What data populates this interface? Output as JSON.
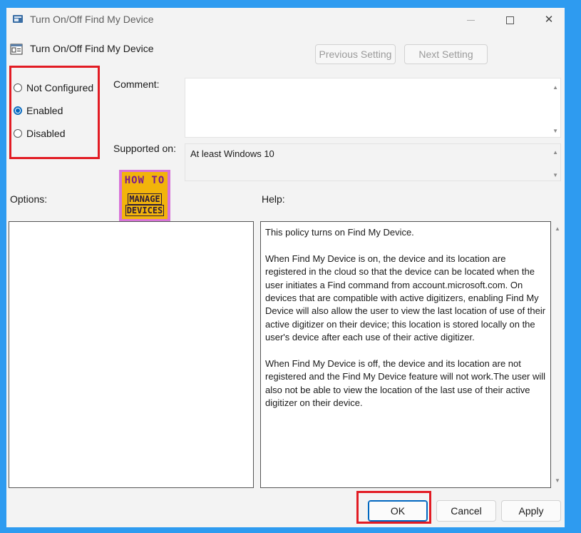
{
  "window": {
    "title": "Turn On/Off Find My Device",
    "controls": {
      "minimize": "–",
      "maximize": "□",
      "close": "✕"
    }
  },
  "header": {
    "policy_title": "Turn On/Off Find My Device",
    "previous_label": "Previous Setting",
    "next_label": "Next Setting"
  },
  "state": {
    "options": [
      {
        "label": "Not Configured",
        "selected": false
      },
      {
        "label": "Enabled",
        "selected": true
      },
      {
        "label": "Disabled",
        "selected": false
      }
    ]
  },
  "fields": {
    "comment_label": "Comment:",
    "comment_value": "",
    "supported_label": "Supported on:",
    "supported_value": "At least Windows 10"
  },
  "panes": {
    "options_label": "Options:",
    "help_label": "Help:",
    "help_paragraphs": [
      "This policy turns on Find My Device.",
      "When Find My Device is on, the device and its location are registered in the cloud so that the device can be located when the user initiates a Find command from account.microsoft.com. On devices that are compatible with active digitizers, enabling Find My Device will also allow the user to view the last location of use of their active digitizer on their device; this location is stored locally on the user's device after each use of their active digitizer.",
      "When Find My Device is off, the device and its location are not registered and the Find My Device feature will not work.The user will also not be able to view the location of the last use of their active digitizer on their device."
    ]
  },
  "watermark": {
    "line1": "HOW TO",
    "line2": "MANAGE",
    "line3": "DEVICES"
  },
  "footer": {
    "ok_label": "OK",
    "cancel_label": "Cancel",
    "apply_label": "Apply"
  },
  "colors": {
    "background": "#2E9BF0",
    "highlight": "#E21B23",
    "accent": "#0067C0"
  }
}
